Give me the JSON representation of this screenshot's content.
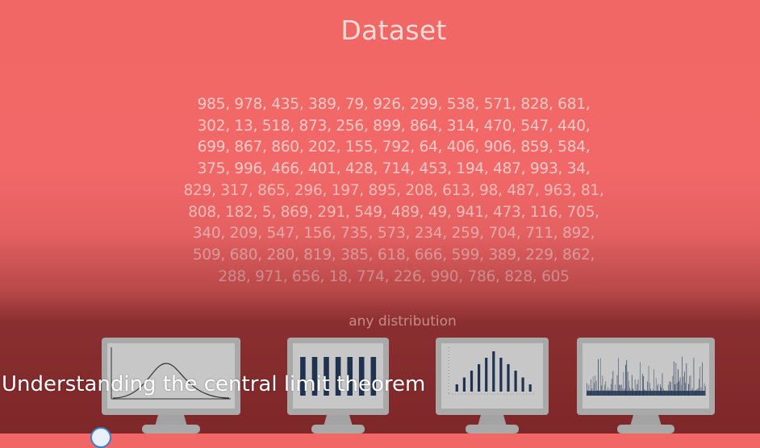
{
  "slide": {
    "title": "Dataset",
    "subtitle": "any distribution",
    "caption": "Understanding the central limit theorem"
  },
  "dataset_lines": [
    "985, 978, 435, 389, 79, 926, 299, 538, 571, 828, 681,",
    "302, 13, 518, 873, 256, 899, 864, 314, 470, 547, 440,",
    "699, 867, 860, 202, 155, 792, 64, 406, 906, 859, 584,",
    "375, 996, 466, 401, 428, 714, 453, 194, 487, 993, 34,",
    "829, 317, 865, 296, 197, 895, 208, 613, 98, 487, 963, 81,",
    "808, 182, 5, 869, 291, 549, 489, 49, 941, 473, 116, 705,",
    "340, 209, 547, 156, 735, 573, 234, 259, 704, 711, 892,",
    "509, 680, 280, 819, 385, 618, 666, 599, 389, 229, 862,",
    "288, 971, 656, 18, 774, 226, 990, 786, 828, 605"
  ],
  "monitors": [
    {
      "name": "normal-distribution-monitor",
      "kind": "curve"
    },
    {
      "name": "uniform-distribution-monitor",
      "kind": "uniform",
      "bar_count": 7
    },
    {
      "name": "triangular-distribution-monitor",
      "kind": "triangular",
      "bar_levels": [
        0.18,
        0.35,
        0.52,
        0.68,
        0.84,
        1.0,
        0.84,
        0.68,
        0.52,
        0.35,
        0.18
      ]
    },
    {
      "name": "random-distribution-monitor",
      "kind": "noise"
    }
  ],
  "colors": {
    "bar": "#1f3350",
    "screen": "#c7c7c7",
    "bezel": "#a9a9a9"
  }
}
